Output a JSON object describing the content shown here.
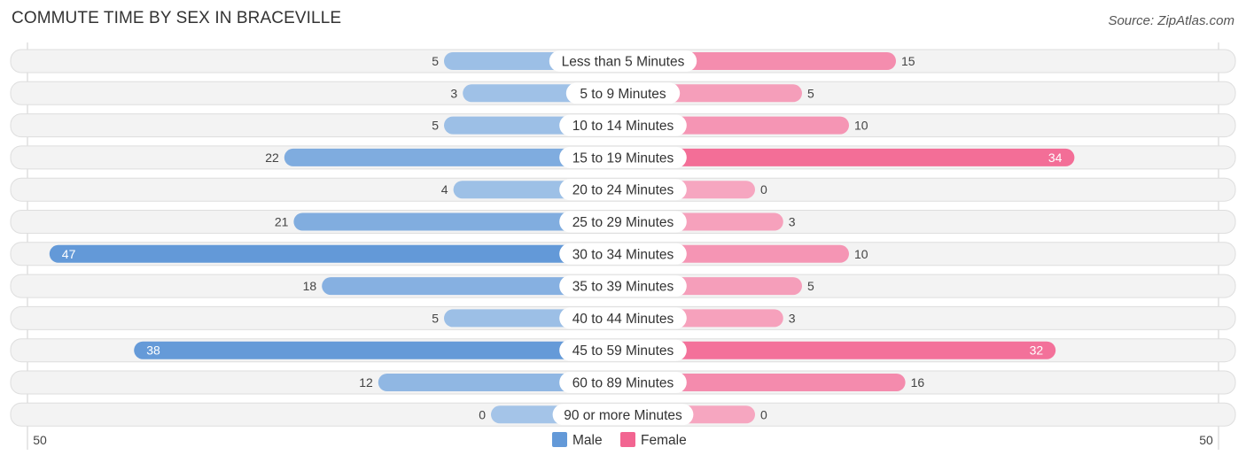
{
  "title": "COMMUTE TIME BY SEX IN BRACEVILLE",
  "source": "Source: ZipAtlas.com",
  "colors": {
    "male_strong": "#6399d8",
    "male_light": "#a4c4e8",
    "female_strong": "#f26591",
    "female_light": "#f6a6c0"
  },
  "chart_data": {
    "type": "bar",
    "orientation": "horizontal-diverging",
    "title": "COMMUTE TIME BY SEX IN BRACEVILLE",
    "categories": [
      "Less than 5 Minutes",
      "5 to 9 Minutes",
      "10 to 14 Minutes",
      "15 to 19 Minutes",
      "20 to 24 Minutes",
      "25 to 29 Minutes",
      "30 to 34 Minutes",
      "35 to 39 Minutes",
      "40 to 44 Minutes",
      "45 to 59 Minutes",
      "60 to 89 Minutes",
      "90 or more Minutes"
    ],
    "series": [
      {
        "name": "Male",
        "values": [
          5,
          3,
          5,
          22,
          4,
          21,
          47,
          18,
          5,
          38,
          12,
          0
        ]
      },
      {
        "name": "Female",
        "values": [
          15,
          5,
          10,
          34,
          0,
          3,
          10,
          5,
          3,
          32,
          16,
          0
        ]
      }
    ],
    "axis": {
      "left_label": "50",
      "right_label": "50",
      "range": [
        -50,
        50
      ]
    },
    "legend": {
      "position": "bottom-center",
      "entries": [
        "Male",
        "Female"
      ]
    },
    "grid": false
  }
}
